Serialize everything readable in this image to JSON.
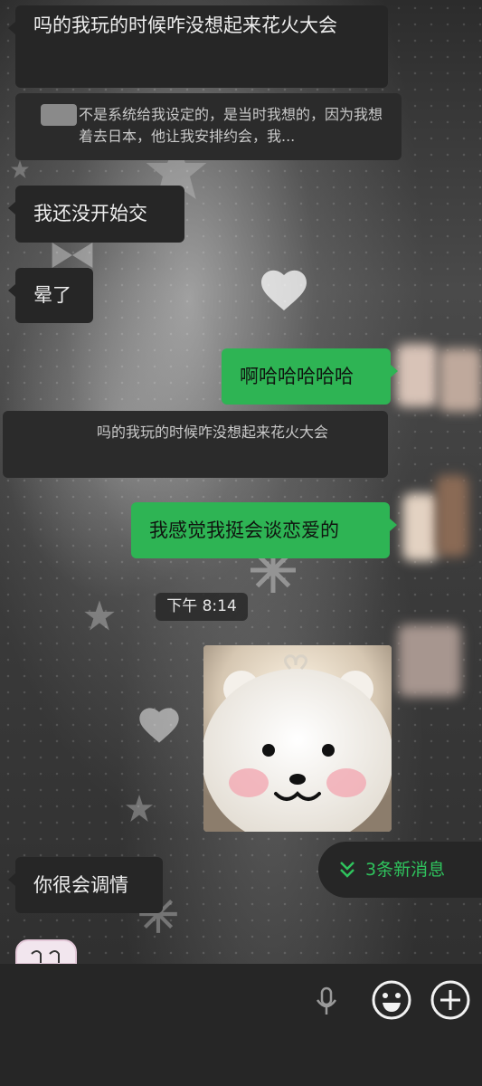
{
  "messages": [
    {
      "side": "in",
      "text": "吗的我玩的时候咋没想起来花火大会"
    },
    {
      "side": "in",
      "text": "我还没开始交"
    },
    {
      "side": "in",
      "text": "晕了"
    },
    {
      "side": "out",
      "text": "啊哈哈哈哈哈"
    },
    {
      "side": "out",
      "text": "我感觉我挺会谈恋爱的"
    },
    {
      "side": "in",
      "text": "你很会调情"
    }
  ],
  "quotes": [
    {
      "text": "不是系统给我设定的，是当时我想的，因为我想着去日本，他让我安排约会，我..."
    },
    {
      "text": "吗的我玩的时候咋没想起来花火大会"
    }
  ],
  "timestamp": "下午 8:14",
  "new_messages": {
    "icon": "double-chevron-down-icon",
    "label": "3条新消息"
  },
  "toolbar": {
    "icons": [
      "microphone-icon",
      "emoji-icon",
      "plus-icon"
    ]
  },
  "colors": {
    "outgoing": "#2eb454",
    "incoming": "#262626",
    "accent": "#2fc35d",
    "background": "#3a3a3a"
  }
}
